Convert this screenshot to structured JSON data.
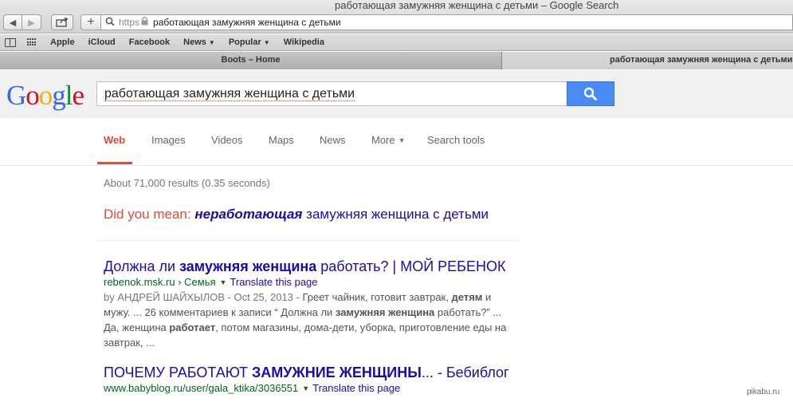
{
  "browser": {
    "window_title": "работающая замужняя женщина с детьми – Google Search",
    "address": {
      "scheme": "https",
      "text": "работающая замужняя женщина с детьми"
    },
    "bookmarks": [
      {
        "label": "Apple",
        "dropdown": false
      },
      {
        "label": "iCloud",
        "dropdown": false
      },
      {
        "label": "Facebook",
        "dropdown": false
      },
      {
        "label": "News",
        "dropdown": true
      },
      {
        "label": "Popular",
        "dropdown": true
      },
      {
        "label": "Wikipedia",
        "dropdown": false
      }
    ],
    "tabs": [
      {
        "label": "Boots – Home"
      },
      {
        "label": "работающая замужняя женщина с детьми"
      }
    ]
  },
  "google": {
    "logo": {
      "letters": [
        "G",
        "o",
        "o",
        "g",
        "l",
        "e"
      ],
      "colors": [
        "#3369e8",
        "#d50f25",
        "#eeb211",
        "#3369e8",
        "#009925",
        "#d50f25"
      ]
    },
    "search": {
      "query": "работающая замужняя женщина с детьми"
    },
    "tabs": [
      {
        "label": "Web",
        "active": true
      },
      {
        "label": "Images"
      },
      {
        "label": "Videos"
      },
      {
        "label": "Maps"
      },
      {
        "label": "News"
      },
      {
        "label": "More"
      },
      {
        "label": "Search tools"
      }
    ],
    "result_stats": "About 71,000 results (0.35 seconds)",
    "did_you_mean": {
      "label": "Did you mean: ",
      "corrected_bold": "неработающая",
      "corrected_rest": " замужняя женщина с детьми"
    },
    "results": [
      {
        "title_pre": "Должна ли ",
        "title_bold": "замужняя женщина",
        "title_post": " работать? | МОЙ РЕБЕНОК",
        "url": "rebenok.msk.ru › Семья",
        "translate": "Translate this page",
        "byline": "by АНДРЕЙ ШАЙХЫЛОВ - Oct 25, 2013 - ",
        "snip1": "Греет чайник, готовит завтрак, ",
        "snip1_b": "детям",
        "snip2": " и мужу. ... 26 комментариев к записи “ Должна ли ",
        "snip2_b": "замужняя женщина",
        "snip3": " работать?” ... Да, женщина ",
        "snip3_b": "работает",
        "snip4": ", потом магазины, дома-дети, уборка, приготовление еды на завтрак, ..."
      },
      {
        "title_pre": "ПОЧЕМУ РАБОТАЮТ ",
        "title_bold": "ЗАМУЖНИЕ ЖЕНЩИНЫ",
        "title_post": "... - Бебиблог",
        "url": "www.babyblog.ru/user/gala_ktika/3036551",
        "translate": "Translate this page"
      }
    ]
  },
  "watermark": "pikabu.ru",
  "colors": {
    "accent_red": "#dd4b39",
    "link_blue": "#1a0dab",
    "url_green": "#006621",
    "search_button": "#4a8af4"
  }
}
